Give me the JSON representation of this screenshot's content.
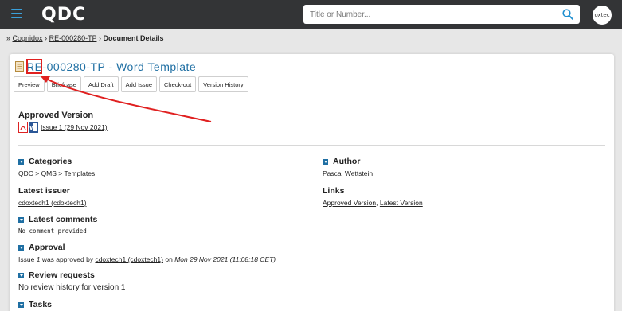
{
  "header": {
    "logo": "QDC",
    "search_placeholder": "Title or Number...",
    "avatar_text": "oxtec"
  },
  "breadcrumb": {
    "prefix": "»",
    "items": [
      "Cognidox",
      "RE-000280-TP"
    ],
    "current": "Document Details",
    "sep": "›"
  },
  "document": {
    "title_prefix": "RE",
    "title_rest": "-000280-TP - Word Template"
  },
  "toolbar": {
    "buttons": [
      "Preview",
      "Briefcase",
      "Add Draft",
      "Add Issue",
      "Check-out",
      "Version History"
    ]
  },
  "approved": {
    "heading": "Approved Version",
    "issue_link": "Issue 1 (29 Nov 2021)"
  },
  "categories": {
    "heading": "Categories",
    "value": "QDC > QMS > Templates"
  },
  "author": {
    "heading": "Author",
    "value": "Pascal Wettstein"
  },
  "latest_issuer": {
    "heading": "Latest issuer",
    "value": "cdoxtech1 (cdoxtech1)"
  },
  "links": {
    "heading": "Links",
    "approved": "Approved Version",
    "comma": ",",
    "latest": "Latest Version"
  },
  "comments": {
    "heading": "Latest comments",
    "value": "No comment provided"
  },
  "approval": {
    "heading": "Approval",
    "issue_word": "Issue",
    "issue_num": "1",
    "text_mid": "was approved by",
    "approver": "cdoxtech1 (cdoxtech1)",
    "on": "on",
    "date": "Mon 29 Nov 2021 (11:08:18 CET)"
  },
  "reviews": {
    "heading": "Review requests",
    "value": "No review history for version 1"
  },
  "tasks": {
    "heading": "Tasks"
  },
  "colors": {
    "topbar": "#333436",
    "accent": "#3aa0db",
    "title": "#1f6fa3",
    "highlight": "#e02020"
  }
}
